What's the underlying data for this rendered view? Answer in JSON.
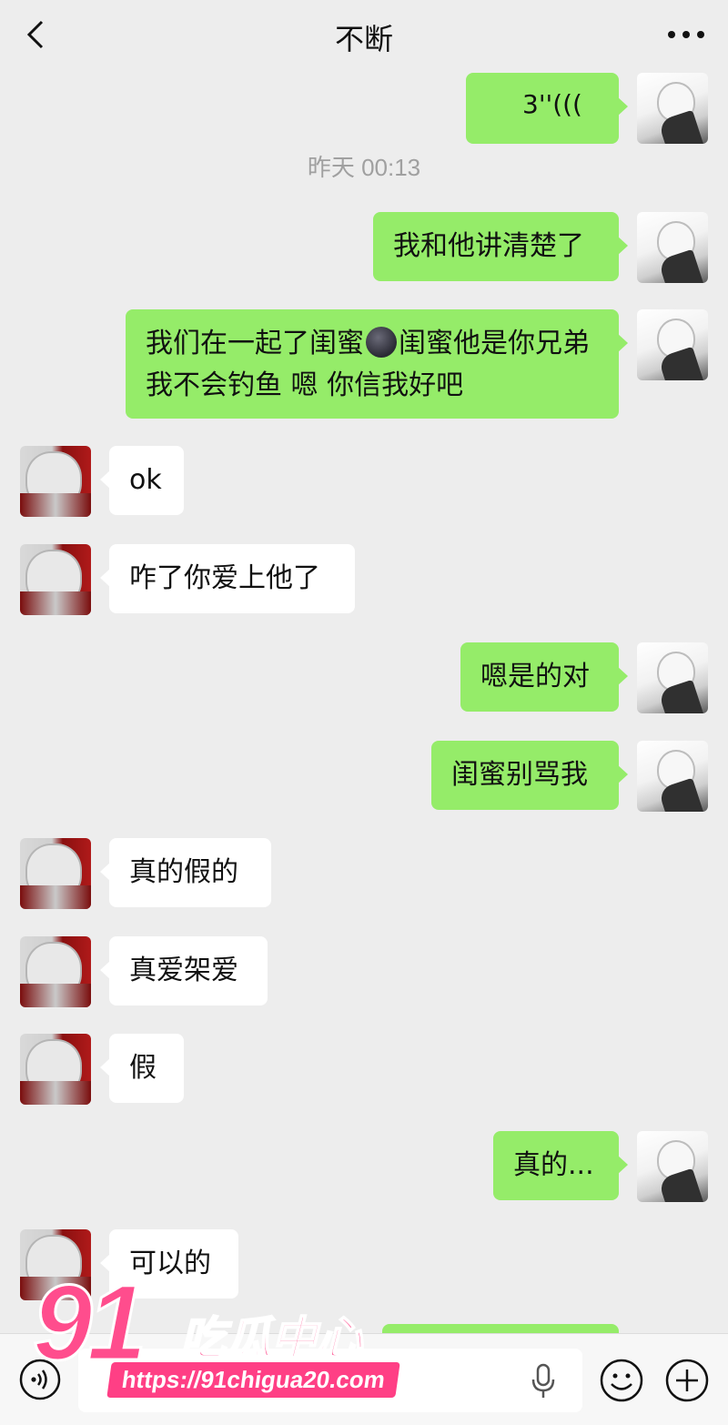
{
  "header": {
    "title": "不断"
  },
  "chat": {
    "timestamp": "昨天 00:13",
    "messages": [
      {
        "sender": "me",
        "text": "3''(((",
        "partial": true
      },
      {
        "sender": "me",
        "text": "我和他讲清楚了"
      },
      {
        "sender": "me",
        "text_before_emoji": "我们在一起了闺蜜",
        "emoji": "dark-moon-face",
        "text_after_emoji": "闺蜜他是你兄弟我不会钓鱼 嗯 你信我好吧"
      },
      {
        "sender": "other",
        "text": "ok"
      },
      {
        "sender": "other",
        "text": "咋了你爱上他了"
      },
      {
        "sender": "me",
        "text": "嗯是的对"
      },
      {
        "sender": "me",
        "text": "闺蜜别骂我"
      },
      {
        "sender": "other",
        "text": "真的假的"
      },
      {
        "sender": "other",
        "text": "真爱架爱"
      },
      {
        "sender": "other",
        "text": "假"
      },
      {
        "sender": "me",
        "text": "真的..."
      },
      {
        "sender": "other",
        "text": "可以的"
      }
    ]
  },
  "input_bar": {
    "voice_icon": "voice-icon",
    "mic_icon": "microphone-icon",
    "emoji_icon": "emoji-icon",
    "plus_icon": "plus-icon"
  },
  "watermark": {
    "digits": "91",
    "name": "吃瓜中心",
    "url": "https://91chigua20.com"
  },
  "colors": {
    "background": "#ededed",
    "bubble_me": "#95ec69",
    "bubble_other": "#ffffff",
    "watermark": "#ff4d8d"
  }
}
